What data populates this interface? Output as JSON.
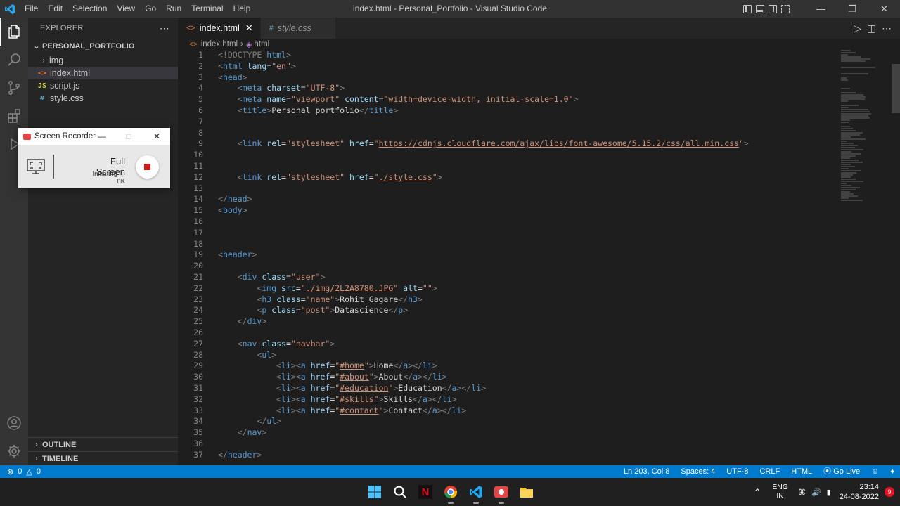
{
  "titlebar": {
    "menu": [
      "File",
      "Edit",
      "Selection",
      "View",
      "Go",
      "Run",
      "Terminal",
      "Help"
    ],
    "title": "index.html - Personal_Portfolio - Visual Studio Code"
  },
  "sidebar": {
    "header": "EXPLORER",
    "folder": "PERSONAL_PORTFOLIO",
    "items": [
      {
        "name": "img",
        "type": "folder"
      },
      {
        "name": "index.html",
        "icon": "<>",
        "selected": true
      },
      {
        "name": "script.js",
        "icon": "JS"
      },
      {
        "name": "style.css",
        "icon": "#"
      }
    ],
    "outline": "OUTLINE",
    "timeline": "TIMELINE"
  },
  "tabs": [
    {
      "label": "index.html",
      "icon": "<>",
      "active": true
    },
    {
      "label": "style.css",
      "icon": "#"
    }
  ],
  "breadcrumb": {
    "file": "index.html",
    "symbol": "html"
  },
  "editor": {
    "line_numbers": [
      "1",
      "2",
      "3",
      "4",
      "5",
      "6",
      "7",
      "8",
      "9",
      "10",
      "11",
      "12",
      "13",
      "14",
      "15",
      "16",
      "17",
      "18",
      "19",
      "20",
      "21",
      "22",
      "23",
      "24",
      "25",
      "26",
      "27",
      "28",
      "29",
      "30",
      "31",
      "32",
      "33",
      "34",
      "35",
      "36",
      "37"
    ]
  },
  "statusbar": {
    "problems": "0",
    "warnings": "0",
    "position": "Ln 203, Col 8",
    "spaces": "Spaces: 4",
    "encoding": "UTF-8",
    "eol": "CRLF",
    "language": "HTML",
    "golive": "Go Live"
  },
  "recorder": {
    "title": "Screen Recorder",
    "mode": "Full Screen",
    "status": "Initiating",
    "size": "0K"
  },
  "taskbar": {
    "lang_top": "ENG",
    "lang_bottom": "IN",
    "time": "23:14",
    "date": "24-08-2022",
    "notifications": "9"
  },
  "colors": {
    "accent": "#007acc",
    "tag": "#569cd6",
    "attr": "#9cdcfe",
    "string": "#ce9178"
  }
}
